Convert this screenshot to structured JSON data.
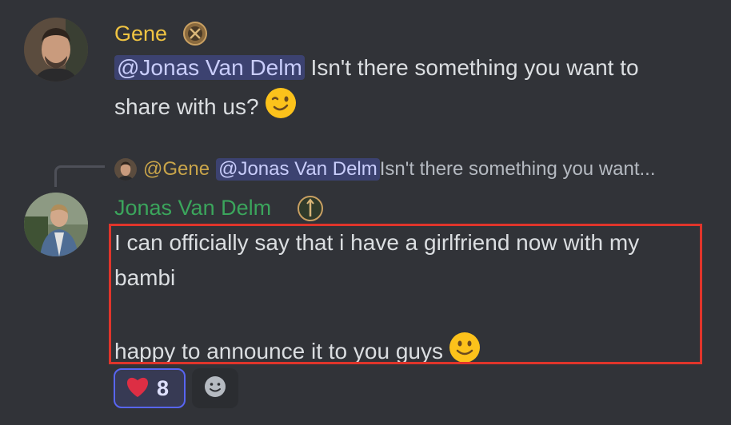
{
  "message1": {
    "author": "Gene",
    "author_color": "#f0c442",
    "mention": "@Jonas Van Delm",
    "text_line1": " Isn't there something you want to",
    "text_line2": "share with us?",
    "emoji": "winking-face"
  },
  "message2": {
    "reply": {
      "author": "@Gene",
      "mention": "@Jonas Van Delm",
      "preview": " Isn't there something you want..."
    },
    "author": "Jonas Van Delm",
    "author_color": "#3ba55c",
    "lines": [
      "I can officially say that i have a girlfriend now with my",
      "bambi",
      "",
      "happy to announce it to you guys"
    ],
    "emoji": "slightly-smiling-face",
    "reactions": [
      {
        "emoji": "heart",
        "count": "8"
      }
    ]
  },
  "colors": {
    "background": "#313338",
    "highlight_border": "#e0352b",
    "mention_bg": "#3c4270",
    "reaction_active_border": "#5865f2"
  }
}
